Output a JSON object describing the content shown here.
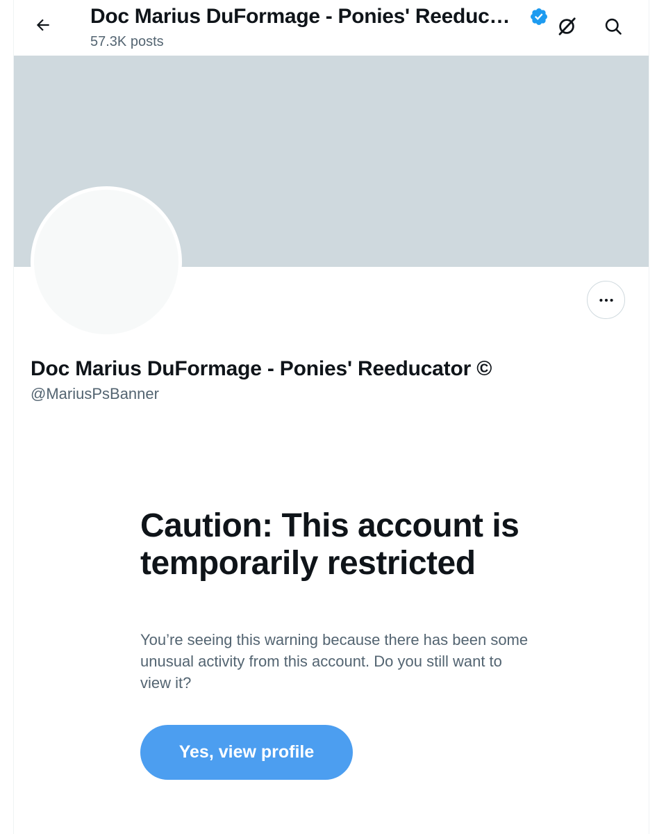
{
  "header": {
    "title": "Doc Marius DuFormage - Ponies' Reeducator ©",
    "posts_count": "57.3K posts",
    "back_icon": "arrow-left-icon",
    "grok_icon": "grok-icon",
    "search_icon": "search-icon",
    "verified_icon": "verified-badge-icon"
  },
  "profile": {
    "display_name": "Doc Marius DuFormage - Ponies' Reeducator ©",
    "handle": "@MariusPsBanner",
    "more_icon": "more-options-icon"
  },
  "warning": {
    "title": "Caution: This account is temporarily restricted",
    "body": "You’re seeing this warning because there has been some unusual activity from this account. Do you still want to view it?",
    "button_label": "Yes, view profile"
  },
  "colors": {
    "banner": "#cfd9de",
    "avatar": "#f7f9f9",
    "button": "#4c9ef0",
    "verified": "#1d9bf0",
    "secondary_text": "#536471"
  }
}
